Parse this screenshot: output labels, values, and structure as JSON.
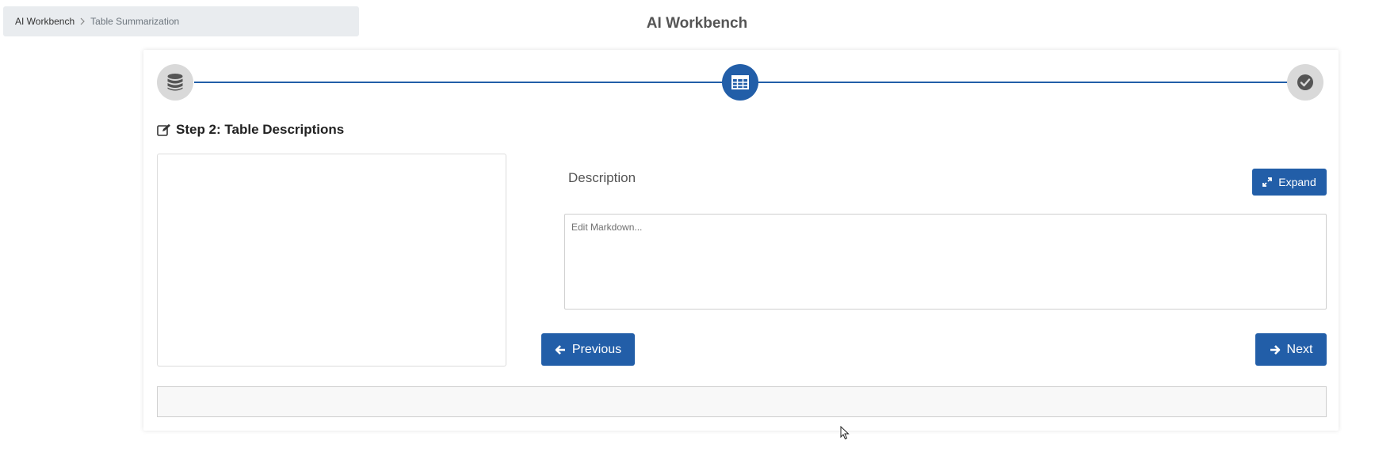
{
  "breadcrumb": {
    "root": "AI Workbench",
    "current": "Table Summarization"
  },
  "header": {
    "title": "AI Workbench"
  },
  "stepper": {
    "steps": [
      {
        "icon": "database-icon",
        "state": "inactive"
      },
      {
        "icon": "table-icon",
        "state": "active"
      },
      {
        "icon": "check-circle-icon",
        "state": "inactive"
      }
    ]
  },
  "step": {
    "heading": "Step 2: Table Descriptions",
    "icon": "edit-icon"
  },
  "description": {
    "label": "Description",
    "expand_label": "Expand",
    "editor_value": "",
    "editor_placeholder": "Edit Markdown..."
  },
  "nav": {
    "previous_label": "Previous",
    "next_label": "Next"
  },
  "colors": {
    "accent": "#225ea8",
    "inactive_step": "#d9d9d9",
    "breadcrumb_bg": "#e9ecef"
  }
}
